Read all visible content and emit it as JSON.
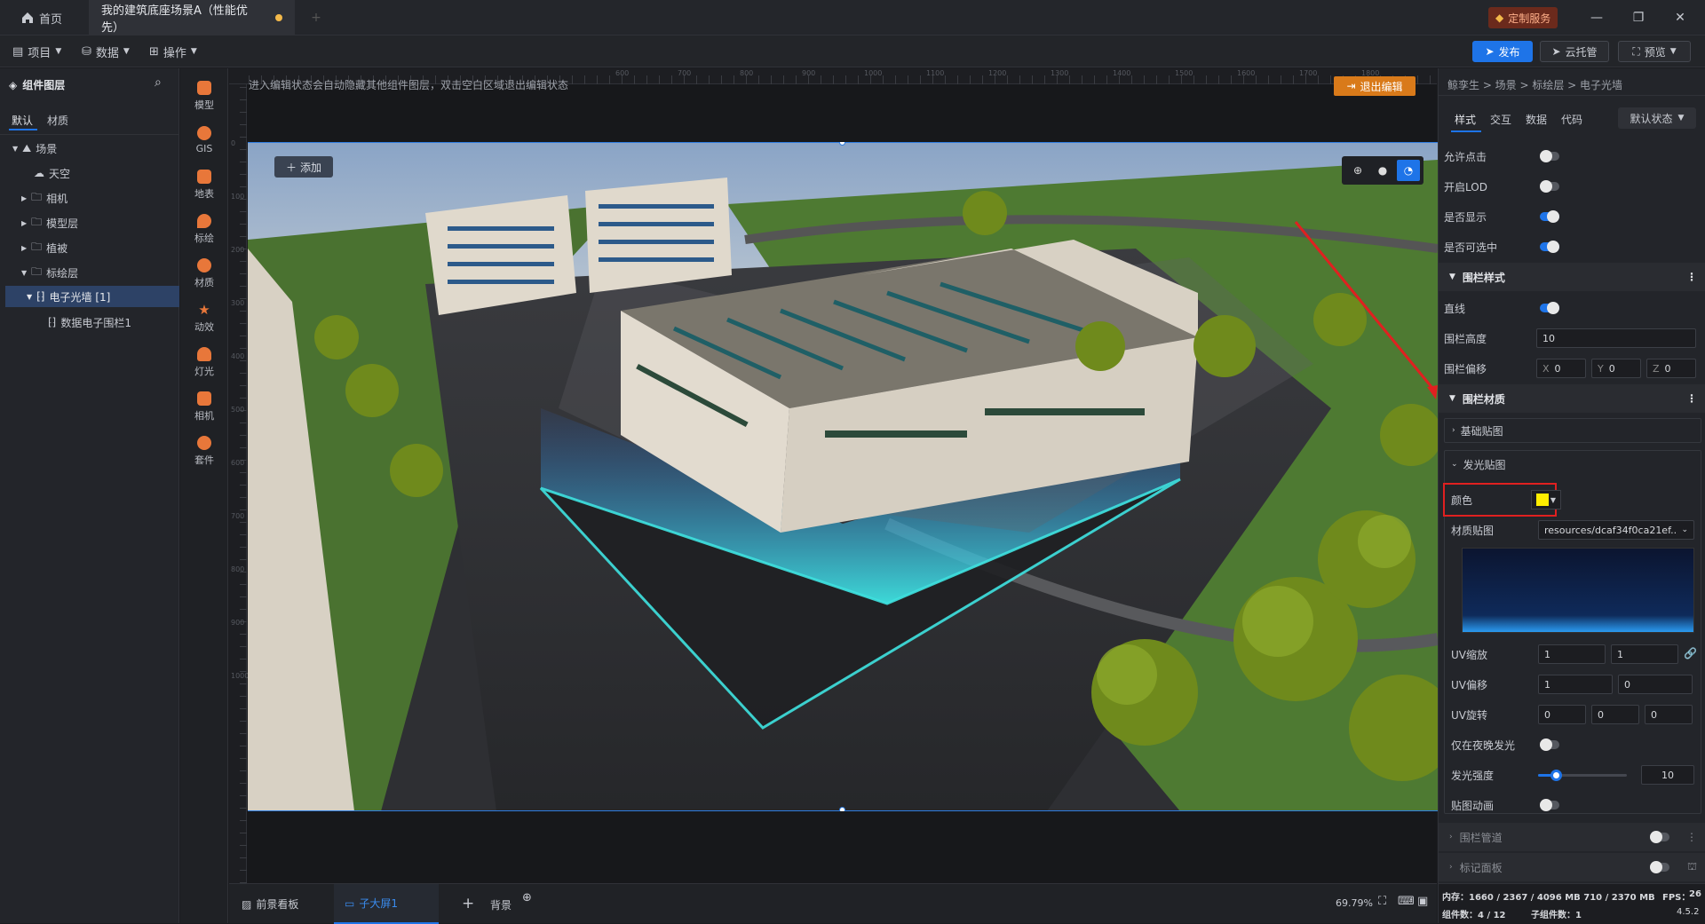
{
  "titlebar": {
    "home_tab": "首页",
    "doc_tab": "我的建筑底座场景A（性能优先）",
    "custom_service": "定制服务"
  },
  "menubar": {
    "project": "项目",
    "data": "数据",
    "operate": "操作",
    "publish": "发布",
    "cloud": "云托管",
    "preview": "预览"
  },
  "left": {
    "title": "组件图层",
    "tabs": [
      "默认",
      "材质"
    ],
    "tree": [
      {
        "label": "场景"
      },
      {
        "label": "天空"
      },
      {
        "label": "相机"
      },
      {
        "label": "模型层"
      },
      {
        "label": "植被"
      },
      {
        "label": "标绘层"
      },
      {
        "label": "电子光墙 [1]"
      },
      {
        "label": "数据电子围栏1"
      }
    ]
  },
  "tools": [
    "模型",
    "GIS",
    "地表",
    "标绘",
    "材质",
    "动效",
    "灯光",
    "相机",
    "套件"
  ],
  "canvas": {
    "hint": "进入编辑状态会自动隐藏其他组件图层，双击空白区域退出编辑状态",
    "exit_edit": "退出编辑",
    "add_button": "添加",
    "ruler_top": [
      "600",
      "700",
      "800",
      "900",
      "1000",
      "1100",
      "1200",
      "1300",
      "1400",
      "1500",
      "1600",
      "1700",
      "1800"
    ],
    "ruler_left": [
      "0",
      "100",
      "200",
      "300",
      "400",
      "500",
      "600",
      "700",
      "800",
      "900",
      "1000"
    ]
  },
  "bottom": {
    "tab_front": "前景看板",
    "tab_sub": "子大屏1",
    "tab_bg": "背景",
    "zoom": "69.79%"
  },
  "right": {
    "breadcrumb": "鲸孪生 > 场景 > 标绘层 > 电子光墙",
    "tabs": [
      "样式",
      "交互",
      "数据",
      "代码"
    ],
    "state": "默认状态",
    "allow_click": "允许点击",
    "lod": "开启LOD",
    "visible": "是否显示",
    "selectable": "是否可选中",
    "fence_style": "围栏样式",
    "straight": "直线",
    "fence_height": "围栏高度",
    "fence_height_val": "10",
    "fence_offset": "围栏偏移",
    "offset_x_label": "X",
    "offset_x": "0",
    "offset_y_label": "Y",
    "offset_y": "0",
    "offset_z_label": "Z",
    "offset_z": "0",
    "fence_material": "围栏材质",
    "base_tex": "基础贴图",
    "glow_tex": "发光贴图",
    "color": "颜色",
    "color_value": "#ffee00",
    "tex": "材质贴图",
    "tex_value": "resources/dcaf34f0ca21ef...",
    "uv_scale": "UV缩放",
    "uv_scale_u": "1",
    "uv_scale_v": "1",
    "uv_offset": "UV偏移",
    "uv_offset_u": "1",
    "uv_offset_v": "0",
    "uv_rot": "UV旋转",
    "uv_rot_a": "0",
    "uv_rot_b": "0",
    "uv_rot_c": "0",
    "night": "仅在夜晚发光",
    "intensity": "发光强度",
    "intensity_val": "10",
    "intensity_level": 0.2,
    "anim": "贴图动画",
    "pipe": "围栏管道",
    "marker": "标记面板"
  },
  "status": {
    "memory": "内存：1660 / 2367 / 4096 MB  710 / 2370 MB",
    "fps_label": "FPS：",
    "fps": "26",
    "comp_count": "组件数：4 / 12",
    "sub_count": "子组件数：1",
    "version": "4.5.2"
  }
}
